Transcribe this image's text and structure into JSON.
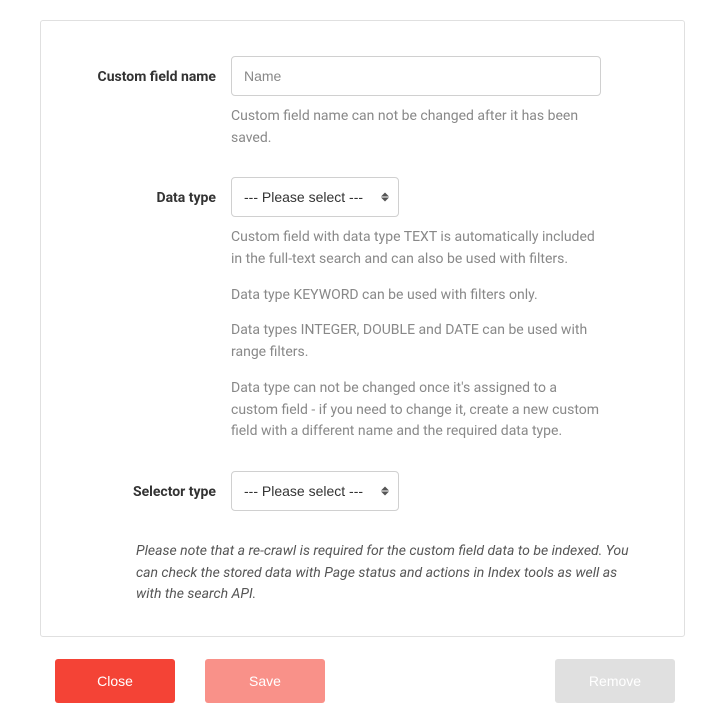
{
  "fields": {
    "name": {
      "label": "Custom field name",
      "placeholder": "Name",
      "value": "",
      "help": "Custom field name can not be changed after it has been saved."
    },
    "dataType": {
      "label": "Data type",
      "selected": "--- Please select ---",
      "help1": "Custom field with data type TEXT is automatically included in the full-text search and can also be used with filters.",
      "help2": "Data type KEYWORD can be used with filters only.",
      "help3": "Data types INTEGER, DOUBLE and DATE can be used with range filters.",
      "help4": "Data type can not be changed once it's assigned to a custom field - if you need to change it, create a new custom field with a different name and the required data type."
    },
    "selectorType": {
      "label": "Selector type",
      "selected": "--- Please select ---"
    }
  },
  "note": "Please note that a re-crawl is required for the custom field data to be indexed. You can check the stored data with Page status and actions in Index tools as well as with the search API.",
  "buttons": {
    "close": "Close",
    "save": "Save",
    "remove": "Remove"
  }
}
